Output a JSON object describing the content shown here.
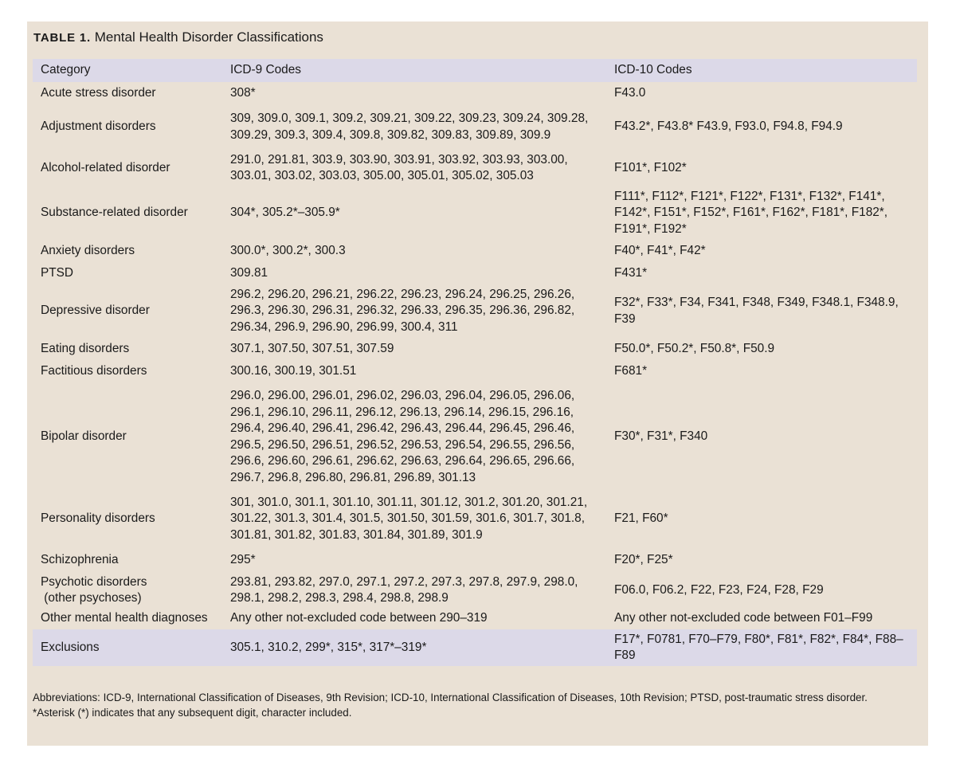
{
  "table": {
    "title_label": "TABLE 1.",
    "title_text": "Mental Health Disorder Classifications",
    "headers": [
      "Category",
      "ICD-9 Codes",
      "ICD-10 Codes"
    ],
    "rows": [
      {
        "category": "Acute stress disorder",
        "icd9": "308*",
        "icd10": "F43.0"
      },
      {
        "category": "Adjustment disorders",
        "icd9": "309, 309.0, 309.1, 309.2, 309.21, 309.22, 309.23, 309.24, 309.28, 309.29, 309.3, 309.4, 309.8, 309.82, 309.83, 309.89, 309.9",
        "icd10": "F43.2*, F43.8* F43.9, F93.0, F94.8, F94.9"
      },
      {
        "category": "Alcohol-related disorder",
        "icd9": "291.0, 291.81, 303.9, 303.90, 303.91, 303.92, 303.93, 303.00, 303.01, 303.02, 303.03, 305.00, 305.01, 305.02, 305.03",
        "icd10": "F101*, F102*"
      },
      {
        "category": "Substance-related disorder",
        "icd9": "304*, 305.2*–305.9*",
        "icd10": "F111*, F112*, F121*, F122*, F131*, F132*, F141*, F142*, F151*, F152*, F161*, F162*, F181*, F182*, F191*, F192*"
      },
      {
        "category": "Anxiety disorders",
        "icd9": "300.0*, 300.2*, 300.3",
        "icd10": "F40*, F41*, F42*"
      },
      {
        "category": "PTSD",
        "icd9": "309.81",
        "icd10": "F431*"
      },
      {
        "category": "Depressive disorder",
        "icd9": "296.2, 296.20, 296.21, 296.22, 296.23, 296.24, 296.25, 296.26, 296.3, 296.30, 296.31, 296.32, 296.33, 296.35, 296.36, 296.82, 296.34, 296.9, 296.90, 296.99, 300.4, 311",
        "icd10": "F32*, F33*, F34, F341, F348, F349, F348.1, F348.9, F39"
      },
      {
        "category": "Eating disorders",
        "icd9": "307.1, 307.50, 307.51, 307.59",
        "icd10": "F50.0*, F50.2*, F50.8*, F50.9"
      },
      {
        "category": "Factitious disorders",
        "icd9": "300.16, 300.19, 301.51",
        "icd10": "F681*"
      },
      {
        "category": "Bipolar disorder",
        "icd9": "296.0, 296.00, 296.01, 296.02, 296.03, 296.04, 296.05, 296.06, 296.1, 296.10, 296.11, 296.12, 296.13, 296.14, 296.15, 296.16, 296.4, 296.40, 296.41, 296.42, 296.43, 296.44, 296.45, 296.46, 296.5, 296.50, 296.51, 296.52, 296.53, 296.54, 296.55, 296.56, 296.6, 296.60, 296.61, 296.62, 296.63, 296.64, 296.65, 296.66, 296.7, 296.8, 296.80, 296.81, 296.89, 301.13",
        "icd10": "F30*, F31*, F340"
      },
      {
        "category": "Personality disorders",
        "icd9": "301, 301.0, 301.1, 301.10, 301.11, 301.12, 301.2, 301.20, 301.21, 301.22, 301.3, 301.4, 301.5, 301.50, 301.59, 301.6, 301.7, 301.8, 301.81, 301.82, 301.83, 301.84, 301.89, 301.9",
        "icd10": "F21, F60*"
      },
      {
        "category": "Schizophrenia",
        "icd9": "295*",
        "icd10": "F20*, F25*"
      },
      {
        "category": "Psychotic disorders\n (other psychoses)",
        "icd9": "293.81, 293.82, 297.0, 297.1, 297.2, 297.3, 297.8, 297.9, 298.0, 298.1, 298.2, 298.3, 298.4, 298.8, 298.9",
        "icd10": "F06.0, F06.2, F22, F23, F24, F28, F29"
      },
      {
        "category": "Other mental health diagnoses",
        "icd9": "Any other not-excluded code between 290–319",
        "icd10": "Any other not-excluded code between F01–F99"
      },
      {
        "category": "Exclusions",
        "icd9": "305.1, 310.2, 299*, 315*, 317*–319*",
        "icd10": "F17*, F0781, F70–F79, F80*, F81*, F82*, F84*, F88–F89"
      }
    ],
    "footnote_abbrev": "Abbreviations: ICD-9, International Classification of Diseases, 9th Revision; ICD-10, International Classification of Diseases, 10th Revision; PTSD, post-traumatic stress disorder.",
    "footnote_asterisk": "*Asterisk (*) indicates that any subsequent digit, character included."
  }
}
